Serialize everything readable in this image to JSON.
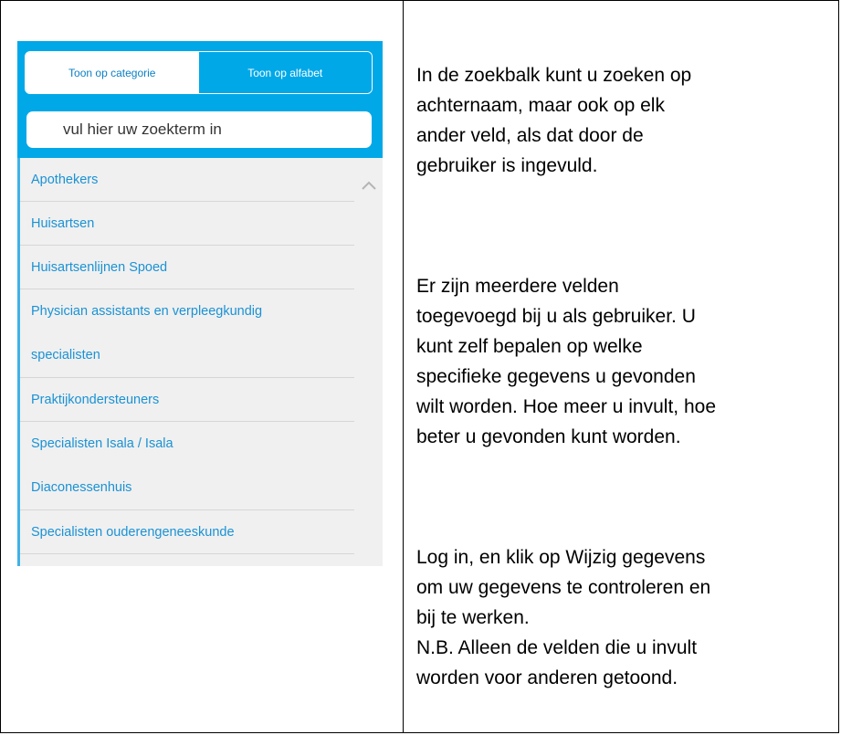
{
  "widget": {
    "toggle": {
      "category_label": "Toon op categorie",
      "alphabet_label": "Toon op alfabet"
    },
    "search": {
      "placeholder": "vul hier uw zoekterm in"
    },
    "list_items": [
      {
        "label": "Apothekers"
      },
      {
        "label": "Huisartsen"
      },
      {
        "label": "Huisartsenlijnen Spoed"
      },
      {
        "label_lines": [
          "Physician assistants en verpleegkundig",
          "specialisten"
        ]
      },
      {
        "label": "Praktijkondersteuners"
      },
      {
        "label_lines": [
          "Specialisten Isala / Isala",
          "Diaconessenhuis"
        ]
      },
      {
        "label": "Specialisten ouderengeneeskunde"
      }
    ]
  },
  "explanation": {
    "paragraph1": [
      "In de zoekbalk kunt u zoeken op",
      "achternaam, maar ook op elk",
      "ander veld, als dat door de",
      "gebruiker is ingevuld."
    ],
    "paragraph2": [
      "Er zijn meerdere velden",
      "toegevoegd bij u als gebruiker. U",
      "kunt zelf bepalen op welke",
      "specifieke gegevens u gevonden",
      "wilt worden. Hoe meer u invult, hoe",
      "beter u gevonden kunt worden."
    ],
    "paragraph3": [
      "Log in, en klik op Wijzig gegevens",
      "om uw gegevens te controleren en",
      "bij te werken.",
      "N.B. Alleen de velden die u invult",
      "worden voor anderen getoond."
    ]
  }
}
